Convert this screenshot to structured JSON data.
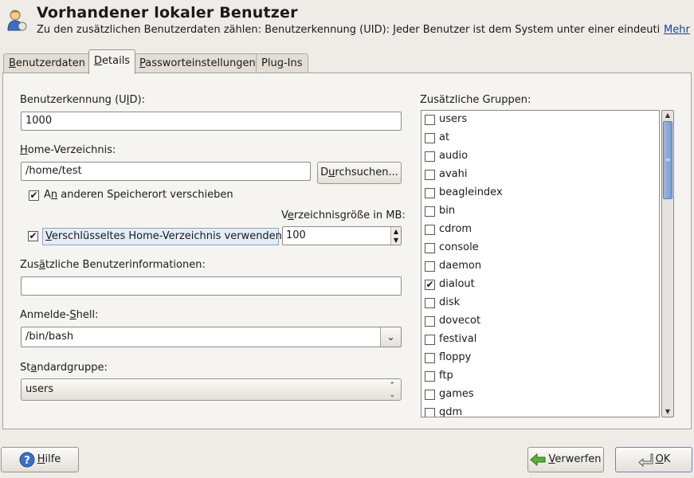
{
  "header": {
    "title": "Vorhandener lokaler Benutzer",
    "description": "Zu den zusätzlichen Benutzerdaten zählen: Benutzerkennung (UID): Jeder Benutzer ist dem System unter einer eindeuti...",
    "more_link": "Mehr",
    "icon": "user-icon"
  },
  "tabs": [
    {
      "pre": "",
      "u": "B",
      "post": "enutzerdaten",
      "active": false
    },
    {
      "pre": "",
      "u": "D",
      "post": "etails",
      "active": true
    },
    {
      "pre": "",
      "u": "P",
      "post": "asswortein­stellungen",
      "active": false
    },
    {
      "pre": "Plu",
      "u": "g",
      "post": "-Ins",
      "active": false
    }
  ],
  "details": {
    "uid_label": {
      "pre": "Benutzerkennung (U",
      "u": "I",
      "post": "D):"
    },
    "uid_value": "1000",
    "home_label": {
      "pre": "",
      "u": "H",
      "post": "ome-Verzeichnis:"
    },
    "home_value": "/home/test",
    "browse_button": {
      "pre": "D",
      "u": "u",
      "post": "rchsuchen..."
    },
    "move_checkbox": {
      "pre": "A",
      "u": "n",
      "post": " anderen Speicherort verschieben",
      "checked": true
    },
    "dir_size_label": {
      "pre": "V",
      "u": "e",
      "post": "rzeichnisgröße in MB:"
    },
    "encrypted_checkbox": {
      "pre": "",
      "u": "V",
      "post": "erschlüsseltes Home-Verzeichnis verwenden",
      "checked": true
    },
    "dir_size_value": "100",
    "info_label": {
      "pre": "Zus",
      "u": "ä",
      "post": "tzliche Benutzerinformationen:"
    },
    "info_value": "",
    "shell_label": {
      "pre": "Anmelde-",
      "u": "S",
      "post": "hell:"
    },
    "shell_value": "/bin/bash",
    "group_label": {
      "pre": "St",
      "u": "a",
      "post": "ndardgruppe:"
    },
    "group_value": "users"
  },
  "groups": {
    "label": "Zusätzliche Gruppen:",
    "items": [
      {
        "name": "users",
        "checked": false
      },
      {
        "name": "at",
        "checked": false
      },
      {
        "name": "audio",
        "checked": false
      },
      {
        "name": "avahi",
        "checked": false
      },
      {
        "name": "beagleindex",
        "checked": false
      },
      {
        "name": "bin",
        "checked": false
      },
      {
        "name": "cdrom",
        "checked": false
      },
      {
        "name": "console",
        "checked": false
      },
      {
        "name": "daemon",
        "checked": false
      },
      {
        "name": "dialout",
        "checked": true
      },
      {
        "name": "disk",
        "checked": false
      },
      {
        "name": "dovecot",
        "checked": false
      },
      {
        "name": "festival",
        "checked": false
      },
      {
        "name": "floppy",
        "checked": false
      },
      {
        "name": "ftp",
        "checked": false
      },
      {
        "name": "games",
        "checked": false
      },
      {
        "name": "gdm",
        "checked": false
      }
    ]
  },
  "footer": {
    "help_button": {
      "pre": "",
      "u": "H",
      "post": "ilfe"
    },
    "discard_button": {
      "pre": "",
      "u": "V",
      "post": "erwerfen"
    },
    "ok_button": {
      "pre": "",
      "u": "O",
      "post": "K"
    }
  },
  "colors": {
    "accent": "#7b9bd0",
    "link": "#1b3fa8",
    "background": "#efebe7"
  }
}
